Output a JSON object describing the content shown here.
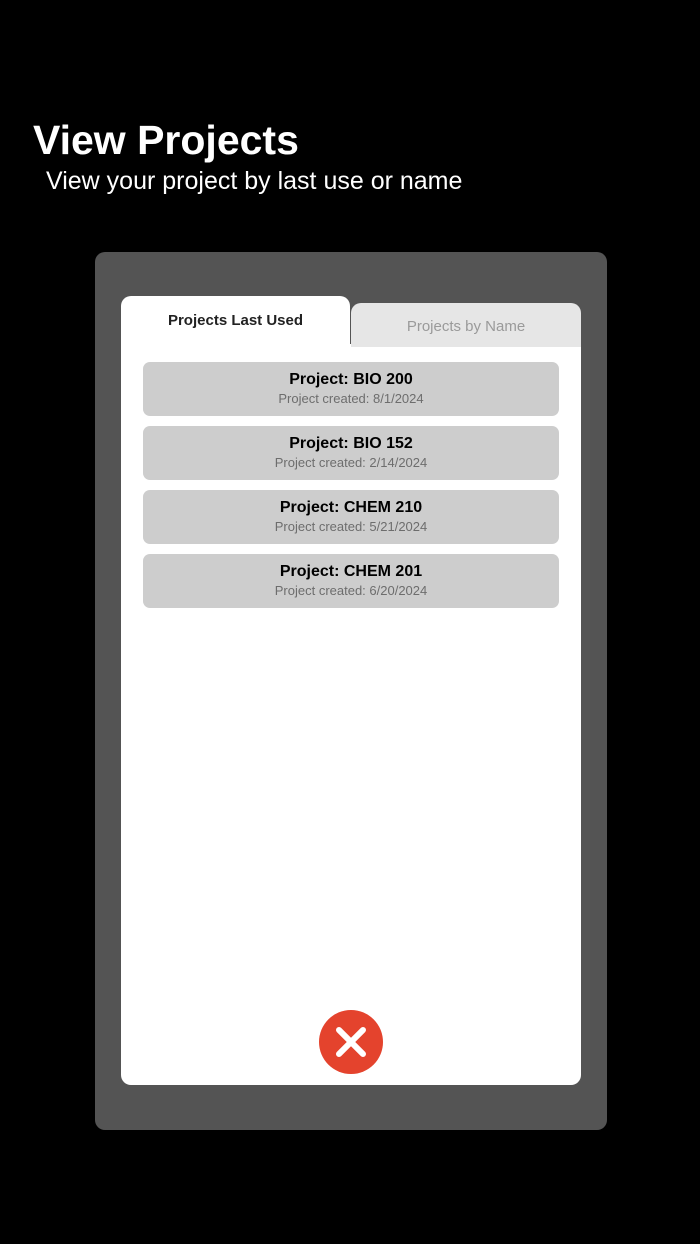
{
  "header": {
    "title": "View Projects",
    "subtitle": "View your project by last use or name"
  },
  "tabs": [
    {
      "label": "Projects Last Used",
      "active": true
    },
    {
      "label": "Projects by Name",
      "active": false
    }
  ],
  "projects": [
    {
      "name": "Project: BIO 200",
      "created": "Project created: 8/1/2024"
    },
    {
      "name": "Project: BIO 152",
      "created": "Project created: 2/14/2024"
    },
    {
      "name": "Project: CHEM 210",
      "created": "Project created: 5/21/2024"
    },
    {
      "name": "Project: CHEM 201",
      "created": "Project created: 6/20/2024"
    }
  ],
  "colors": {
    "background": "#000000",
    "panel": "#545454",
    "card": "#ffffff",
    "project_item": "#cdcdcd",
    "close_button": "#e4432d"
  },
  "icons": {
    "close": "close-icon"
  }
}
